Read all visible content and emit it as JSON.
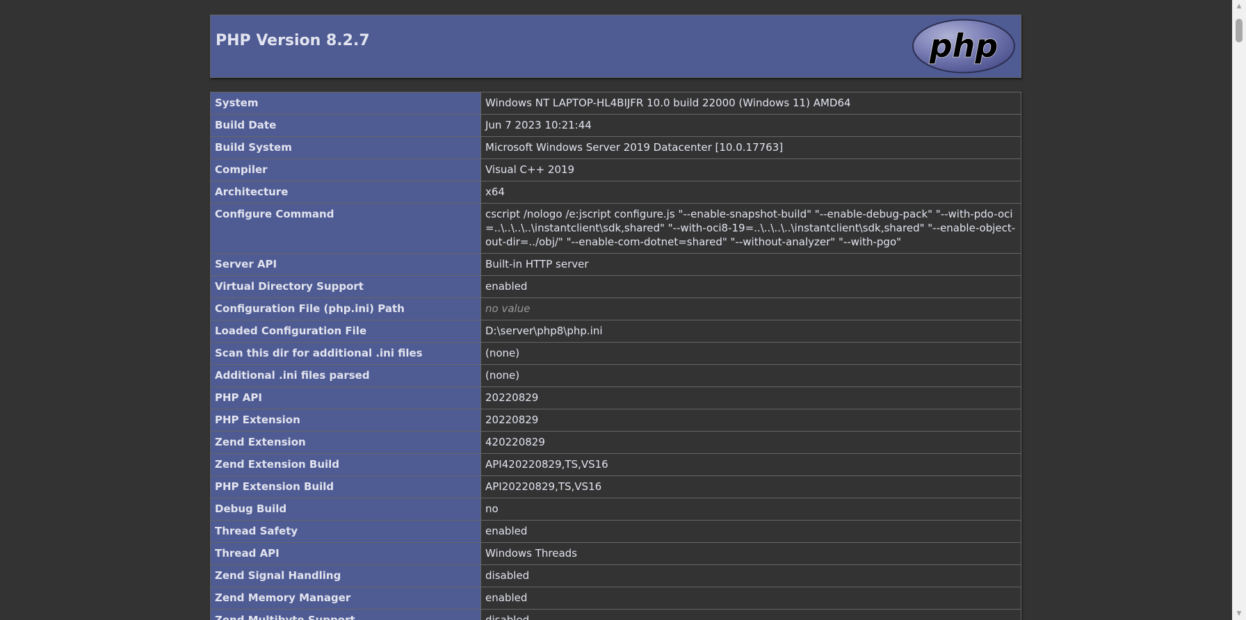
{
  "header": {
    "title": "PHP Version 8.2.7",
    "logo_text": "php",
    "colors": {
      "header_bg": "#4f5b93",
      "page_bg": "#333333",
      "text": "#e2e4ef",
      "logo_fill": "#777bb3"
    }
  },
  "rows": [
    {
      "label": "System",
      "value": "Windows NT LAPTOP-HL4BIJFR 10.0 build 22000 (Windows 11) AMD64"
    },
    {
      "label": "Build Date",
      "value": "Jun 7 2023 10:21:44"
    },
    {
      "label": "Build System",
      "value": "Microsoft Windows Server 2019 Datacenter [10.0.17763]"
    },
    {
      "label": "Compiler",
      "value": "Visual C++ 2019"
    },
    {
      "label": "Architecture",
      "value": "x64"
    },
    {
      "label": "Configure Command",
      "value": "cscript /nologo /e:jscript configure.js \"--enable-snapshot-build\" \"--enable-debug-pack\" \"--with-pdo-oci=..\\..\\..\\..\\instantclient\\sdk,shared\" \"--with-oci8-19=..\\..\\..\\..\\instantclient\\sdk,shared\" \"--enable-object-out-dir=../obj/\" \"--enable-com-dotnet=shared\" \"--without-analyzer\" \"--with-pgo\""
    },
    {
      "label": "Server API",
      "value": "Built-in HTTP server"
    },
    {
      "label": "Virtual Directory Support",
      "value": "enabled"
    },
    {
      "label": "Configuration File (php.ini) Path",
      "value": "no value",
      "novalue": true
    },
    {
      "label": "Loaded Configuration File",
      "value": "D:\\server\\php8\\php.ini"
    },
    {
      "label": "Scan this dir for additional .ini files",
      "value": "(none)"
    },
    {
      "label": "Additional .ini files parsed",
      "value": "(none)"
    },
    {
      "label": "PHP API",
      "value": "20220829"
    },
    {
      "label": "PHP Extension",
      "value": "20220829"
    },
    {
      "label": "Zend Extension",
      "value": "420220829"
    },
    {
      "label": "Zend Extension Build",
      "value": "API420220829,TS,VS16"
    },
    {
      "label": "PHP Extension Build",
      "value": "API20220829,TS,VS16"
    },
    {
      "label": "Debug Build",
      "value": "no"
    },
    {
      "label": "Thread Safety",
      "value": "enabled"
    },
    {
      "label": "Thread API",
      "value": "Windows Threads"
    },
    {
      "label": "Zend Signal Handling",
      "value": "disabled"
    },
    {
      "label": "Zend Memory Manager",
      "value": "enabled"
    },
    {
      "label": "Zend Multibyte Support",
      "value": "disabled"
    }
  ]
}
